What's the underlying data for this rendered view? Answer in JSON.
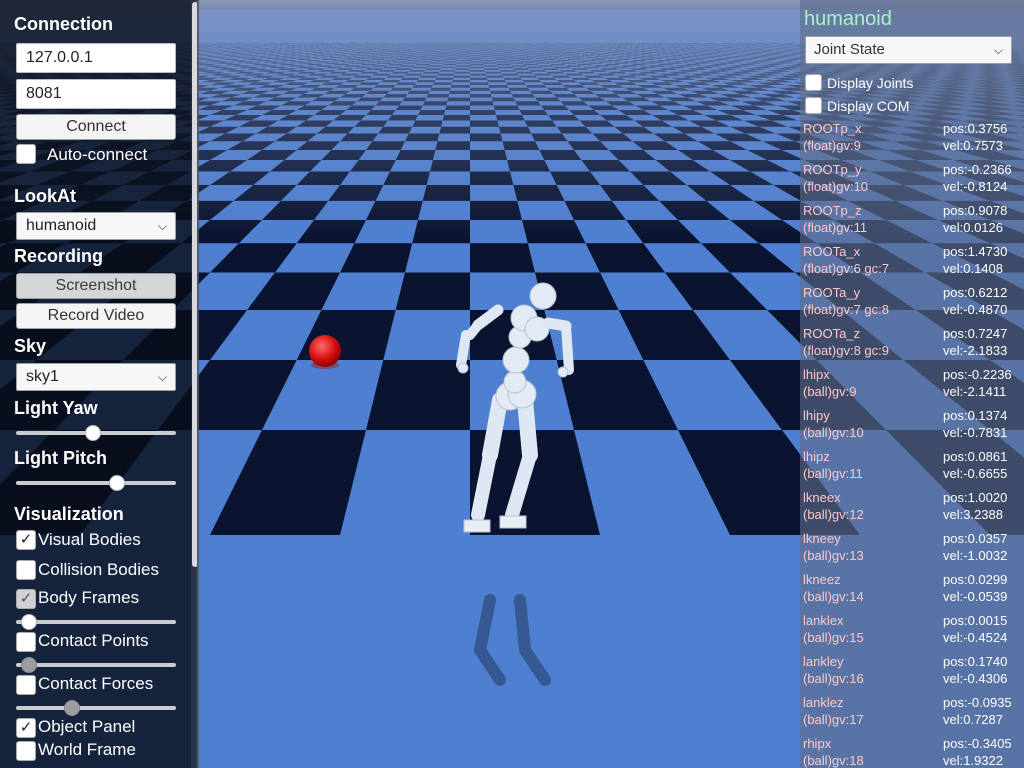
{
  "connection": {
    "title": "Connection",
    "host": "127.0.0.1",
    "port": "8081",
    "connect_label": "Connect",
    "auto_connect_label": "Auto-connect"
  },
  "lookat": {
    "title": "LookAt",
    "value": "humanoid"
  },
  "recording": {
    "title": "Recording",
    "screenshot_label": "Screenshot",
    "record_label": "Record Video"
  },
  "sky": {
    "title": "Sky",
    "value": "sky1"
  },
  "light": {
    "yaw_title": "Light Yaw",
    "yaw_value": 0.48,
    "pitch_title": "Light Pitch",
    "pitch_value": 0.63
  },
  "visualization": {
    "title": "Visualization",
    "visual_bodies": "Visual Bodies",
    "collision_bodies": "Collision Bodies",
    "body_frames": "Body Frames",
    "body_frames_slider": 0.08,
    "contact_points": "Contact Points",
    "contact_points_slider": 0.08,
    "contact_forces": "Contact Forces",
    "contact_forces_slider": 0.35,
    "object_panel": "Object Panel",
    "world_frame": "World Frame",
    "check_mark": "✓"
  },
  "icons": {
    "dropdown": "chevron-down-icon",
    "check": "checkmark-icon"
  },
  "object_panel": {
    "title": "humanoid",
    "state_value": "Joint State",
    "display_joints": "Display Joints",
    "display_com": "Display COM",
    "joints": [
      {
        "name": "ROOTp_x",
        "type": "(float)gv:9",
        "pos": "pos:0.3756",
        "vel": "vel:0.7573"
      },
      {
        "name": "ROOTp_y",
        "type": "(float)gv:10",
        "pos": "pos:-0.2366",
        "vel": "vel:-0.8124"
      },
      {
        "name": "ROOTp_z",
        "type": "(float)gv:11",
        "pos": "pos:0.9078",
        "vel": "vel:0.0126"
      },
      {
        "name": "ROOTa_x",
        "type": "(float)gv:6 gc:7",
        "pos": "pos:1.4730",
        "vel": "vel:0.1408"
      },
      {
        "name": "ROOTa_y",
        "type": "(float)gv:7 gc:8",
        "pos": "pos:0.6212",
        "vel": "vel:-0.4870"
      },
      {
        "name": "ROOTa_z",
        "type": "(float)gv:8 gc:9",
        "pos": "pos:0.7247",
        "vel": "vel:-2.1833"
      },
      {
        "name": "lhipx",
        "type": "(ball)gv:9",
        "pos": "pos:-0.2236",
        "vel": "vel:-2.1411"
      },
      {
        "name": "lhipy",
        "type": "(ball)gv:10",
        "pos": "pos:0.1374",
        "vel": "vel:-0.7831"
      },
      {
        "name": "lhipz",
        "type": "(ball)gv:11",
        "pos": "pos:0.0861",
        "vel": "vel:-0.6655"
      },
      {
        "name": "lkneex",
        "type": "(ball)gv:12",
        "pos": "pos:1.0020",
        "vel": "vel:3.2388"
      },
      {
        "name": "lkneey",
        "type": "(ball)gv:13",
        "pos": "pos:0.0357",
        "vel": "vel:-1.0032"
      },
      {
        "name": "lkneez",
        "type": "(ball)gv:14",
        "pos": "pos:0.0299",
        "vel": "vel:-0.0539"
      },
      {
        "name": "lanklex",
        "type": "(ball)gv:15",
        "pos": "pos:0.0015",
        "vel": "vel:-0.4524"
      },
      {
        "name": "lankley",
        "type": "(ball)gv:16",
        "pos": "pos:0.1740",
        "vel": "vel:-0.4306"
      },
      {
        "name": "lanklez",
        "type": "(ball)gv:17",
        "pos": "pos:-0.0935",
        "vel": "vel:0.7287"
      },
      {
        "name": "rhipx",
        "type": "(ball)gv:18",
        "pos": "pos:-0.3405",
        "vel": "vel:1.9322"
      }
    ]
  }
}
